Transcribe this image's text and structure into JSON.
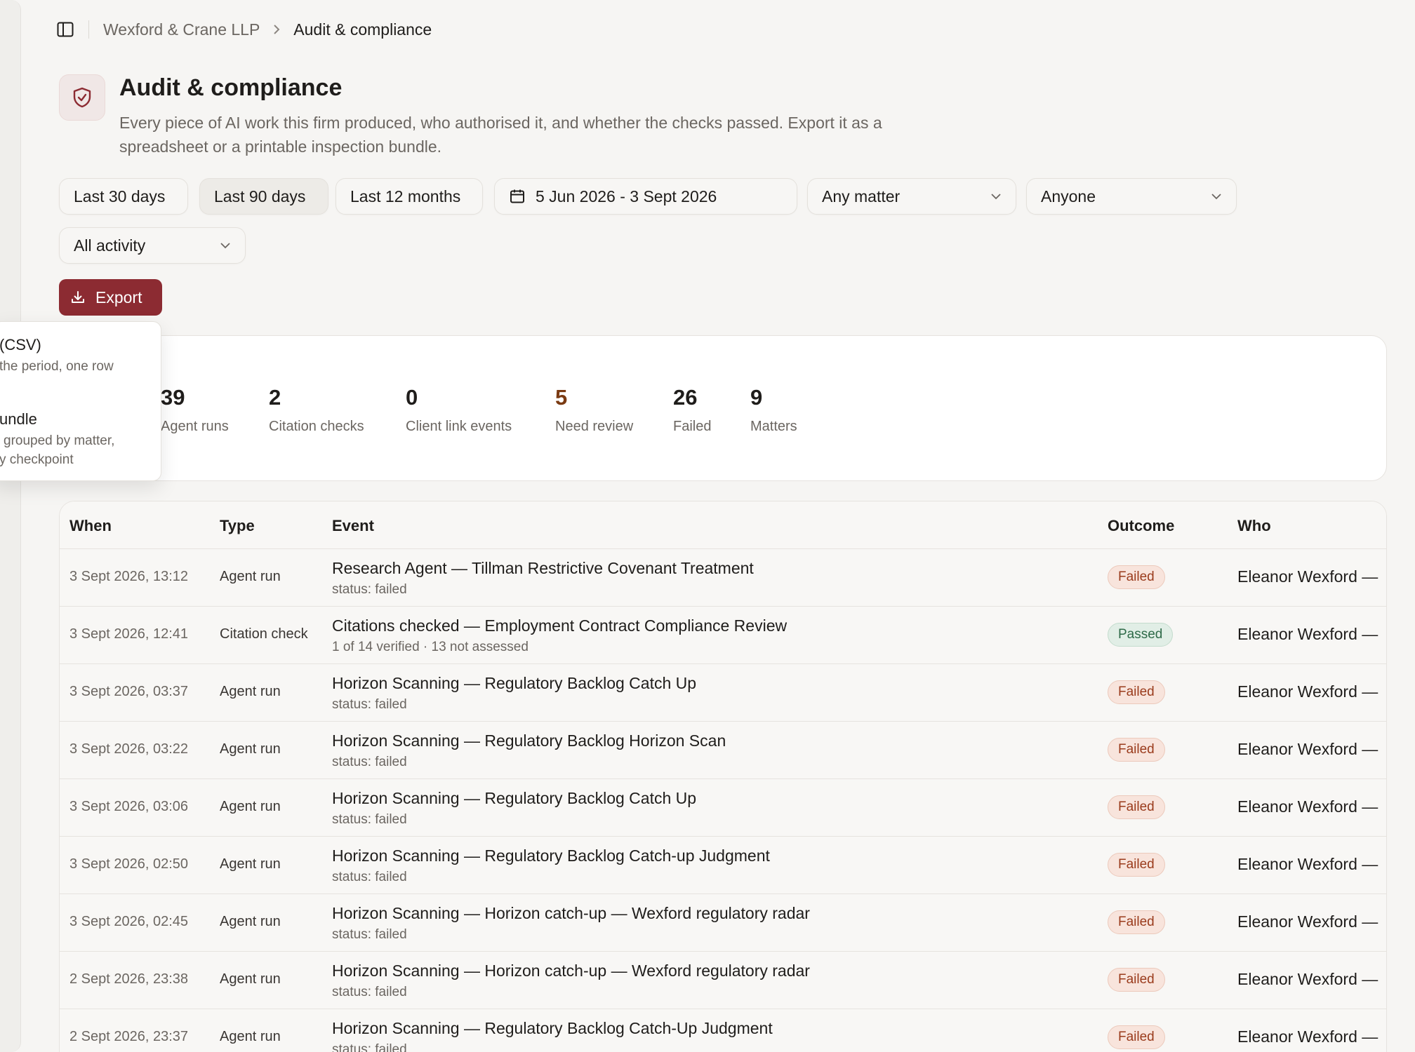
{
  "breadcrumb": {
    "firm": "Wexford & Crane LLP",
    "current": "Audit & compliance"
  },
  "header": {
    "title": "Audit & compliance",
    "description": "Every piece of AI work this firm produced, who authorised it, and whether the checks passed. Export it as a spreadsheet or a printable inspection bundle."
  },
  "filters": {
    "range_buttons": [
      "Last 30 days",
      "Last 90 days",
      "Last 12 months"
    ],
    "active_range": "Last 90 days",
    "date_range": "5 Jun 2026 - 3 Sept 2026",
    "matter_select": "Any matter",
    "person_select": "Anyone",
    "activity_select": "All activity"
  },
  "export": {
    "label": "Export",
    "menu": {
      "item1_title": "(CSV)",
      "item1_desc": "the period, one row",
      "item2_title": "undle",
      "item2_desc_line1": "grouped by matter,",
      "item2_desc_line2": "y checkpoint"
    }
  },
  "stats": [
    {
      "value": "39",
      "label": "Agent runs"
    },
    {
      "value": "2",
      "label": "Citation checks"
    },
    {
      "value": "0",
      "label": "Client link events"
    },
    {
      "value": "5",
      "label": "Need review"
    },
    {
      "value": "26",
      "label": "Failed"
    },
    {
      "value": "9",
      "label": "Matters"
    }
  ],
  "table": {
    "columns": {
      "when": "When",
      "type": "Type",
      "event": "Event",
      "outcome": "Outcome",
      "who": "Who"
    },
    "rows": [
      {
        "when": "3 Sept 2026, 13:12",
        "type": "Agent run",
        "event": "Research Agent — Tillman Restrictive Covenant Treatment",
        "sub": "status: failed",
        "outcome": "Failed",
        "who": "Eleanor Wexford —"
      },
      {
        "when": "3 Sept 2026, 12:41",
        "type": "Citation check",
        "event": "Citations checked — Employment Contract Compliance Review",
        "sub": "1 of 14 verified · 13 not assessed",
        "outcome": "Passed",
        "who": "Eleanor Wexford —"
      },
      {
        "when": "3 Sept 2026, 03:37",
        "type": "Agent run",
        "event": "Horizon Scanning — Regulatory Backlog Catch Up",
        "sub": "status: failed",
        "outcome": "Failed",
        "who": "Eleanor Wexford —"
      },
      {
        "when": "3 Sept 2026, 03:22",
        "type": "Agent run",
        "event": "Horizon Scanning — Regulatory Backlog Horizon Scan",
        "sub": "status: failed",
        "outcome": "Failed",
        "who": "Eleanor Wexford —"
      },
      {
        "when": "3 Sept 2026, 03:06",
        "type": "Agent run",
        "event": "Horizon Scanning — Regulatory Backlog Catch Up",
        "sub": "status: failed",
        "outcome": "Failed",
        "who": "Eleanor Wexford —"
      },
      {
        "when": "3 Sept 2026, 02:50",
        "type": "Agent run",
        "event": "Horizon Scanning — Regulatory Backlog Catch-up Judgment",
        "sub": "status: failed",
        "outcome": "Failed",
        "who": "Eleanor Wexford —"
      },
      {
        "when": "3 Sept 2026, 02:45",
        "type": "Agent run",
        "event": "Horizon Scanning — Horizon catch-up — Wexford regulatory radar",
        "sub": "status: failed",
        "outcome": "Failed",
        "who": "Eleanor Wexford —"
      },
      {
        "when": "2 Sept 2026, 23:38",
        "type": "Agent run",
        "event": "Horizon Scanning — Horizon catch-up — Wexford regulatory radar",
        "sub": "status: failed",
        "outcome": "Failed",
        "who": "Eleanor Wexford —"
      },
      {
        "when": "2 Sept 2026, 23:37",
        "type": "Agent run",
        "event": "Horizon Scanning — Regulatory Backlog Catch-Up Judgment",
        "sub": "status: failed",
        "outcome": "Failed",
        "who": "Eleanor Wexford —"
      }
    ]
  },
  "colors": {
    "accent": "#8c2b32",
    "failed_bg": "#f8e4dc",
    "passed_bg": "#e1eee6"
  },
  "icons": {
    "sidebar_toggle": "sidebar-panel-icon",
    "breadcrumb_sep": "chevron-right-icon",
    "header": "shield-check-icon",
    "calendar": "calendar-icon",
    "dropdown": "chevron-down-icon",
    "export": "download-icon"
  }
}
